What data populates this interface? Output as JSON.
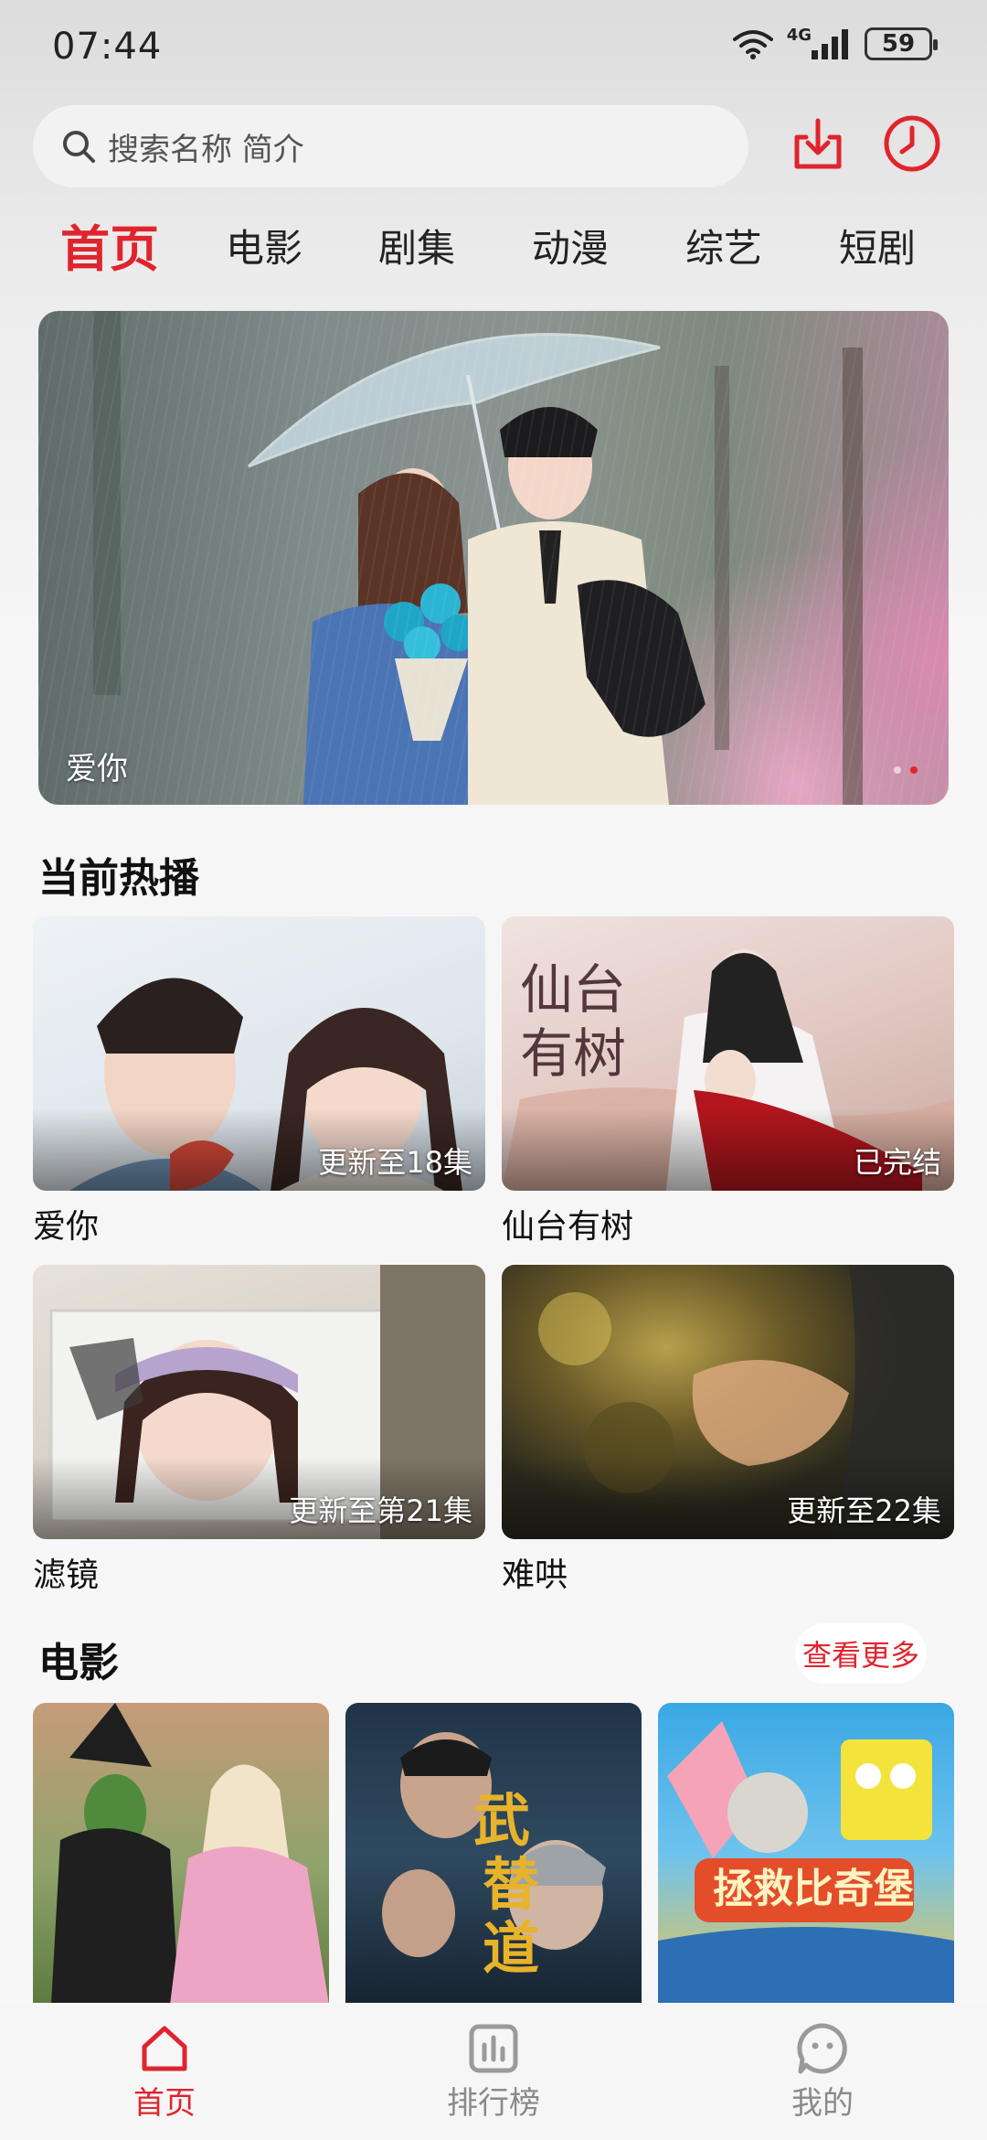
{
  "status_bar": {
    "time": "07:44",
    "network": "4G",
    "battery": "59"
  },
  "search": {
    "placeholder": "搜索名称 简介"
  },
  "tabs": [
    {
      "label": "首页",
      "active": true
    },
    {
      "label": "电影"
    },
    {
      "label": "剧集"
    },
    {
      "label": "动漫"
    },
    {
      "label": "综艺"
    },
    {
      "label": "短剧"
    }
  ],
  "banner": {
    "title": "爱你",
    "dots": 2,
    "active_dot": 1
  },
  "hot": {
    "title": "当前热播",
    "items": [
      {
        "name": "爱你",
        "badge": "更新至18集"
      },
      {
        "name": "仙台有树",
        "badge": "已完结"
      },
      {
        "name": "滤镜",
        "badge": "更新至第21集"
      },
      {
        "name": "难哄",
        "badge": "更新至22集"
      }
    ]
  },
  "movies": {
    "title": "电影",
    "more_label": "查看更多"
  },
  "bottom_nav": [
    {
      "label": "首页",
      "icon": "home-icon",
      "active": true
    },
    {
      "label": "排行榜",
      "icon": "chart-icon"
    },
    {
      "label": "我的",
      "icon": "smile-icon"
    }
  ],
  "colors": {
    "accent": "#e0242e"
  }
}
